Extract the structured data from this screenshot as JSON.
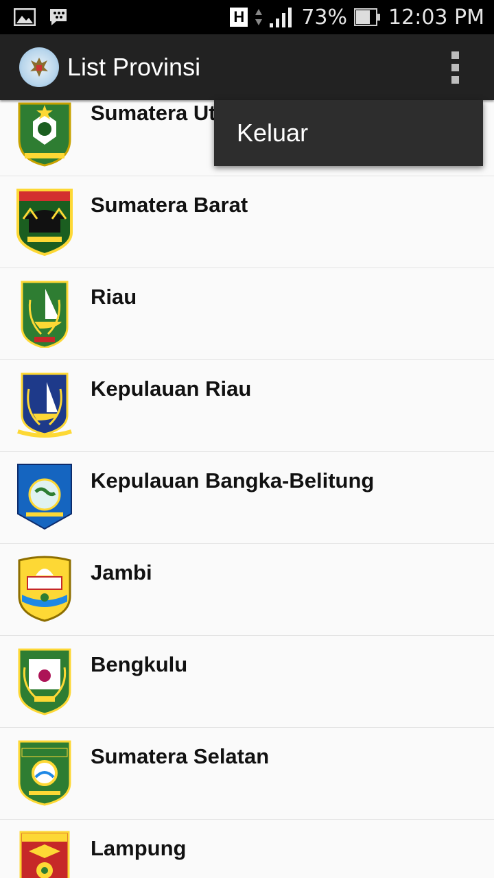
{
  "status": {
    "battery": "73%",
    "time": "12:03 PM",
    "network": "H"
  },
  "app": {
    "title": "List Provinsi"
  },
  "menu": {
    "logout": "Keluar"
  },
  "provinces": [
    {
      "name": "Sumatera Utara",
      "display": "Sumatera Ut"
    },
    {
      "name": "Sumatera Barat"
    },
    {
      "name": "Riau"
    },
    {
      "name": "Kepulauan Riau"
    },
    {
      "name": "Kepulauan Bangka-Belitung"
    },
    {
      "name": "Jambi"
    },
    {
      "name": "Bengkulu"
    },
    {
      "name": "Sumatera Selatan"
    },
    {
      "name": "Lampung"
    }
  ]
}
